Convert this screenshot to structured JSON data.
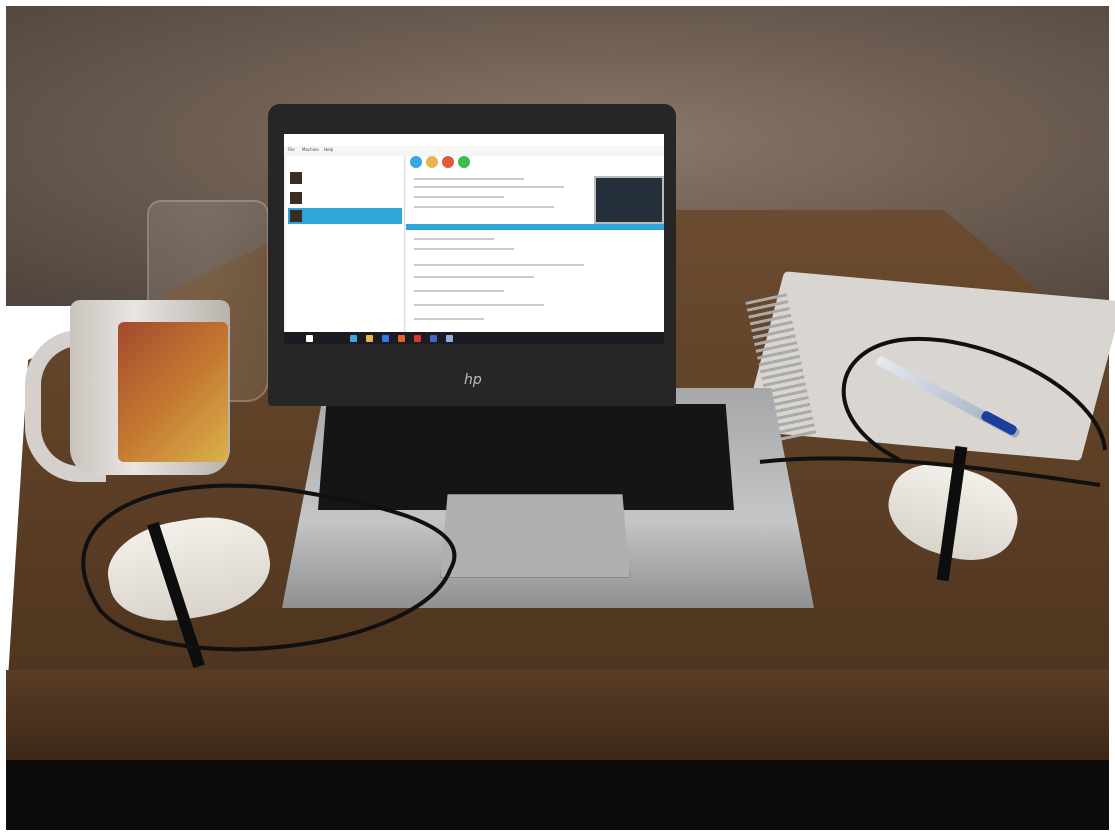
{
  "scene": {
    "description_free": true,
    "objects": [
      "wall",
      "table",
      "glass",
      "mug",
      "notebook",
      "pen",
      "laptop",
      "usb-dongle-left",
      "usb-dongle-right",
      "cables"
    ],
    "colors": {
      "screen_accent": "#2fa6d9",
      "dongle": "#ece8e1",
      "antenna": "#0d0d0d",
      "pen_cap": "#1d3f9c"
    }
  },
  "laptop": {
    "brand_mark": "hp",
    "screen": {
      "app_menu": [
        "File",
        "Machine",
        "Help"
      ],
      "vm_items": [
        {
          "name": "",
          "state": ""
        },
        {
          "name": "",
          "state": ""
        },
        {
          "name": "",
          "state": ""
        }
      ]
    }
  }
}
